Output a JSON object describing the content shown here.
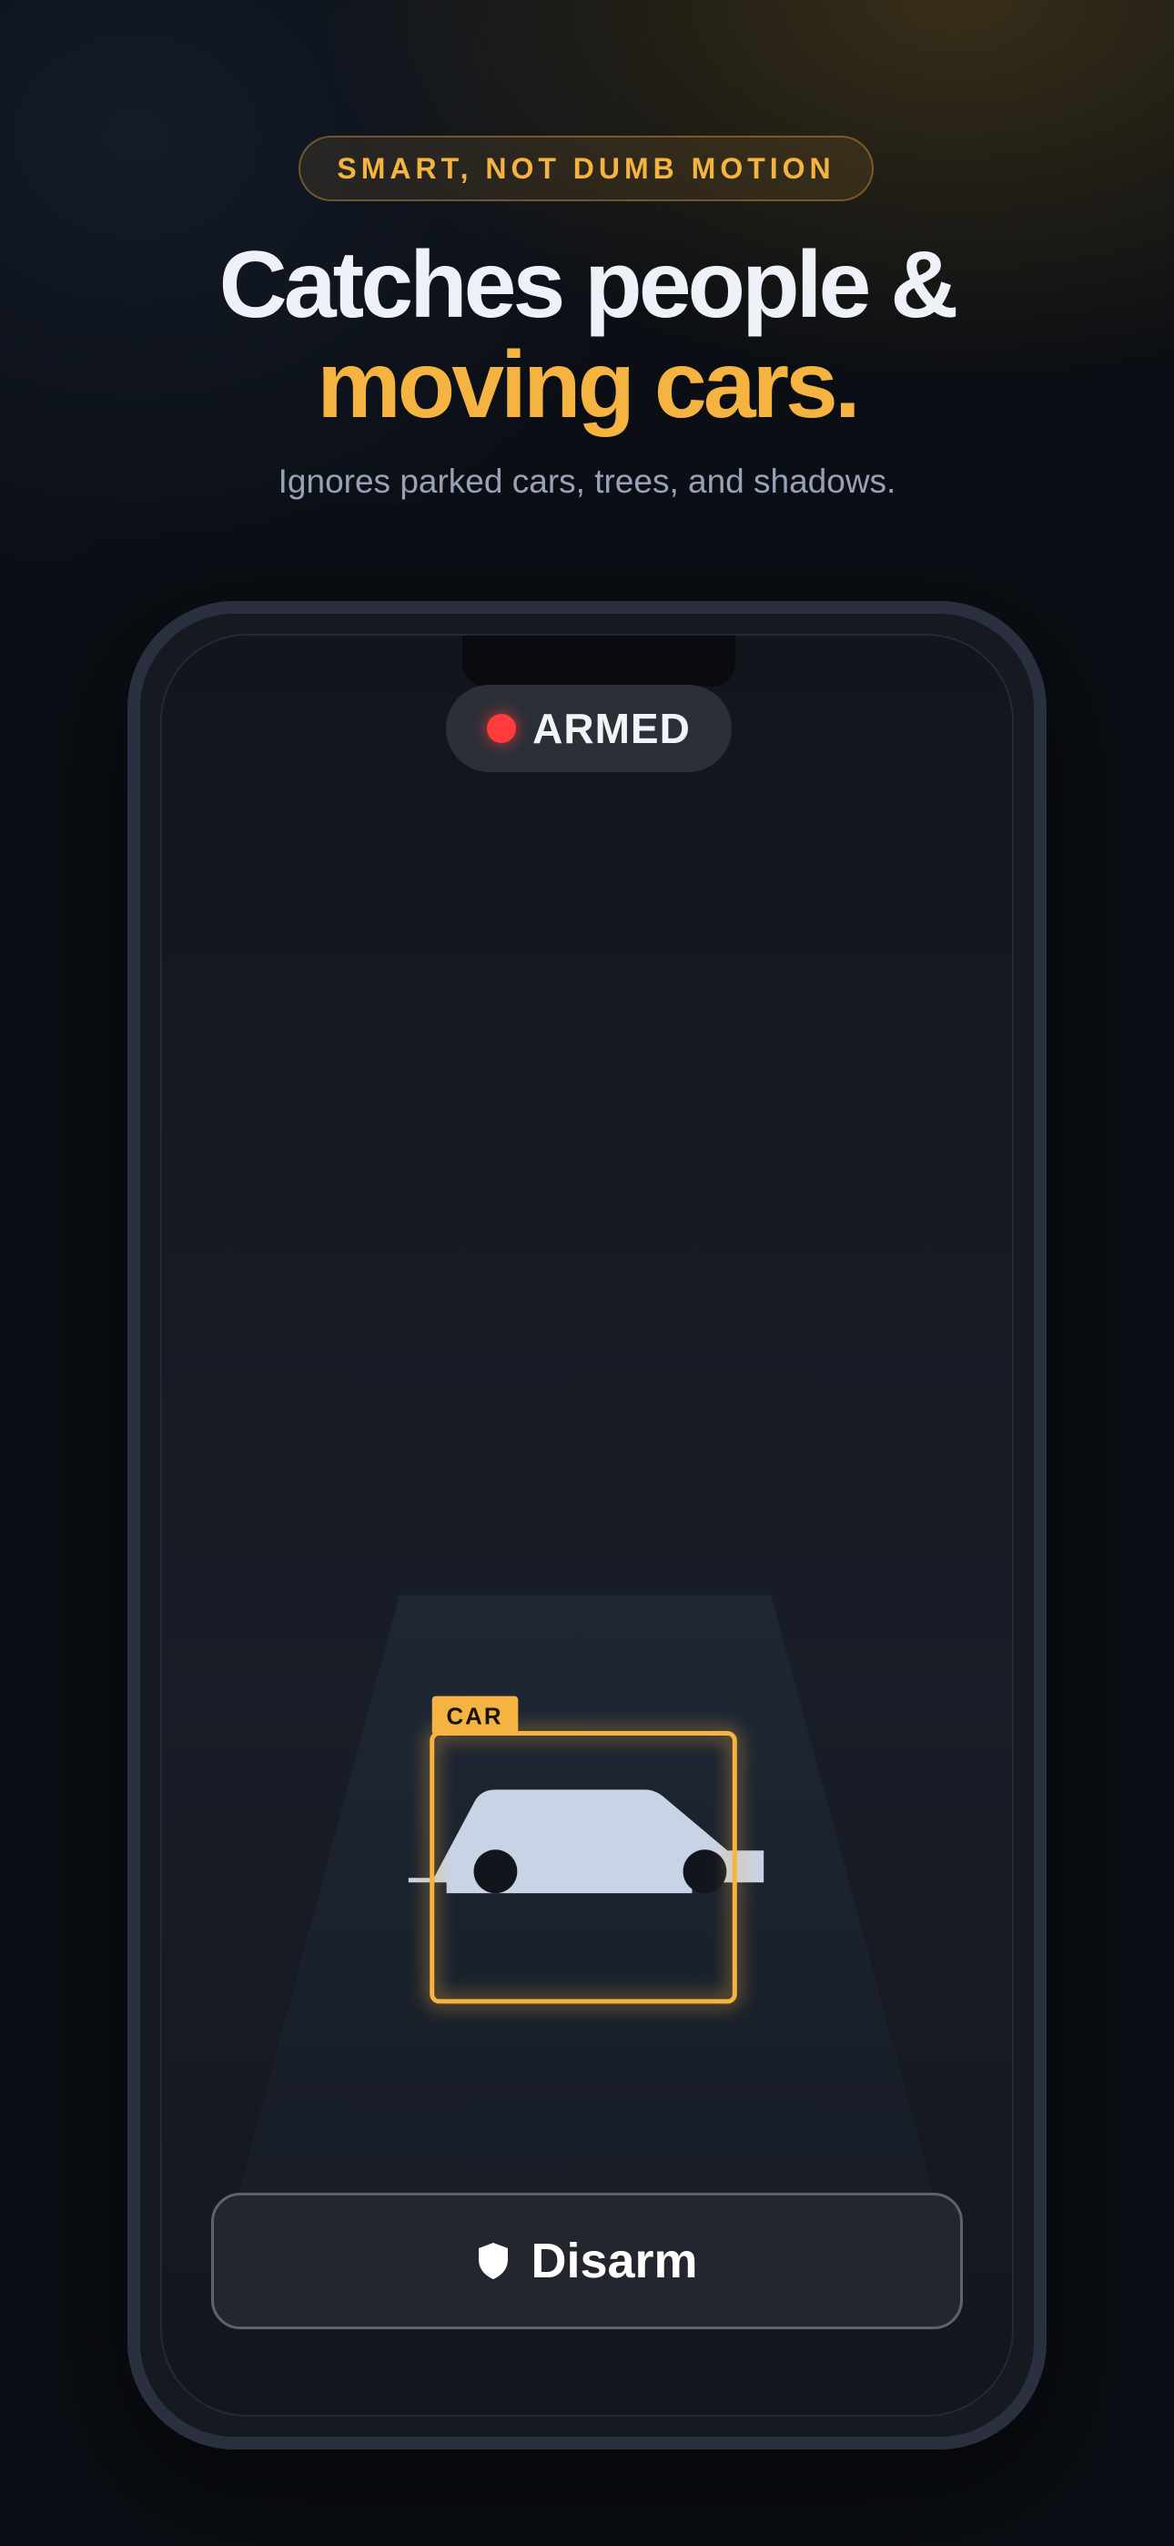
{
  "eyebrow": "SMART, NOT DUMB MOTION",
  "headline": {
    "line1": "Catches people &",
    "line2": "moving cars."
  },
  "subtitle": "Ignores parked cars, trees, and shadows.",
  "phone": {
    "status": {
      "text": "ARMED",
      "dot_color": "#ff3b3b"
    },
    "detection": {
      "label": "CAR",
      "color": "#f5b342"
    },
    "disarm_button": {
      "label": "Disarm",
      "icon": "shield-icon"
    }
  },
  "colors": {
    "accent": "#f5b342",
    "background": "#0b0e14",
    "armed": "#ff3b3b"
  }
}
